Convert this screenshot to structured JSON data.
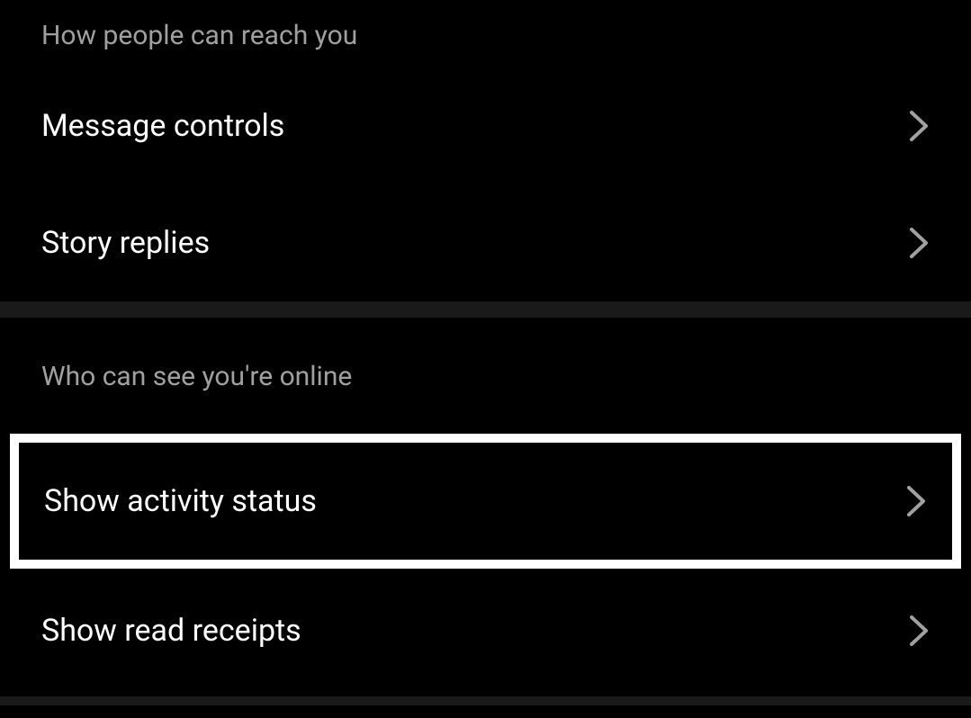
{
  "sections": [
    {
      "header": "How people can reach you",
      "items": [
        {
          "label": "Message controls"
        },
        {
          "label": "Story replies"
        }
      ]
    },
    {
      "header": "Who can see you're online",
      "items": [
        {
          "label": "Show activity status",
          "highlighted": true
        },
        {
          "label": "Show read receipts"
        }
      ]
    }
  ]
}
